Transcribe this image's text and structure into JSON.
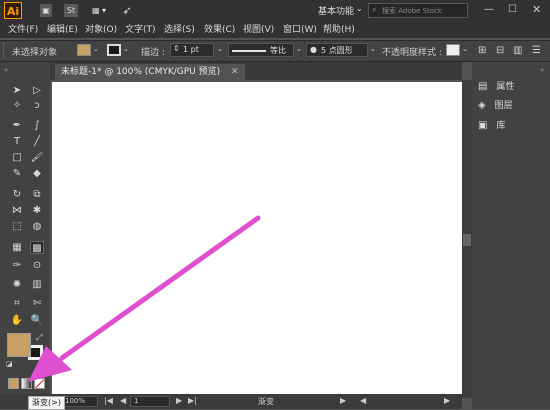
{
  "app": {
    "logo": "Ai",
    "title_icons": [
      "St"
    ],
    "workspace_label": "基本功能",
    "search_placeholder": "搜索 Adobe Stock"
  },
  "menu": [
    "文件(F)",
    "编辑(E)",
    "对象(O)",
    "文字(T)",
    "选择(S)",
    "效果(C)",
    "视图(V)",
    "窗口(W)",
    "帮助(H)"
  ],
  "control_bar": {
    "selection_label": "未选择对象",
    "fill_color": "#c8a064",
    "stroke_label": "描边 :",
    "stroke_value": "1 pt",
    "stroke_profile": "等比",
    "brush_size": "5 点圆形",
    "opacity_label": "不透明度",
    "style_label": "样式 :"
  },
  "document_tab": {
    "title": "未标题-1* @ 100% (CMYK/GPU 预览)"
  },
  "right_panel": {
    "items": [
      "属性",
      "图层",
      "库"
    ]
  },
  "status_bar": {
    "zoom": "100%",
    "page": "1",
    "tool_name": "渐变"
  },
  "tooltip": "渐变(>)",
  "colors": {
    "fill_swatch": "#c8a064",
    "accent": "#ff9a00",
    "arrow": "#e04fd0"
  }
}
